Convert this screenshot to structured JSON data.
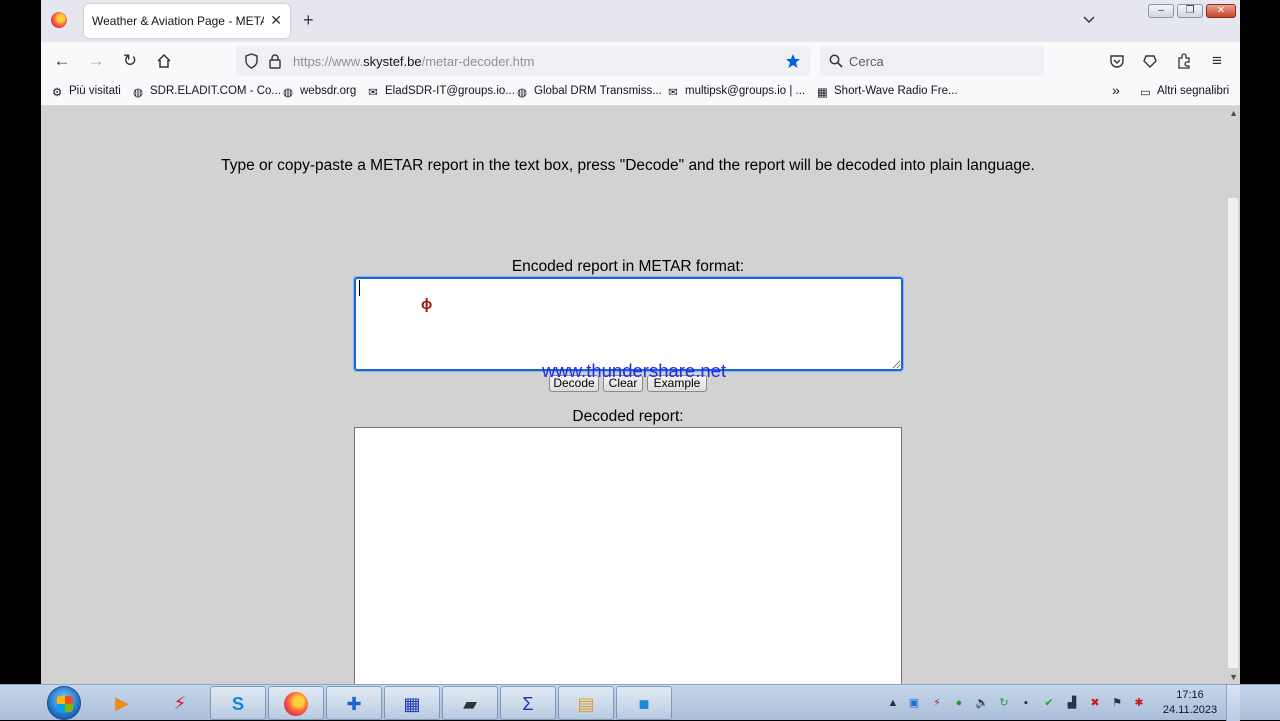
{
  "browser": {
    "tab_title": "Weather & Aviation Page - METAR",
    "tab_close": "✕",
    "new_tab": "+",
    "url_prefix": "https://www.",
    "url_domain": "skystef.be",
    "url_path": "/metar-decoder.htm",
    "search_placeholder": "Cerca",
    "window_buttons": {
      "minimize": "–",
      "maximize": "❐",
      "close": "✕"
    }
  },
  "bookmarks": [
    {
      "label": "Più visitati",
      "icon": "gear-icon"
    },
    {
      "label": "SDR.ELADIT.COM - Co...",
      "icon": "globe-icon"
    },
    {
      "label": "websdr.org",
      "icon": "globe-icon"
    },
    {
      "label": "EladSDR-IT@groups.io...",
      "icon": "mail-icon"
    },
    {
      "label": "Global DRM Transmiss...",
      "icon": "globe-icon"
    },
    {
      "label": "multipsk@groups.io | ...",
      "icon": "mail-icon"
    },
    {
      "label": "Short-Wave Radio Fre...",
      "icon": "radio-icon"
    }
  ],
  "bookmarks_more": "»",
  "bookmarks_other": "Altri segnalibri",
  "page": {
    "intro": "Type or copy-paste a METAR report in the text box, press \"Decode\" and the report will be decoded into plain language.",
    "encoded_label": "Encoded report in METAR format:",
    "encoded_value": "",
    "watermark": "www.thundershare.net",
    "buttons": {
      "decode": "Decode",
      "clear": "Clear",
      "example": "Example"
    },
    "decoded_label": "Decoded report:",
    "cursor_glyph": "ϕ"
  },
  "taskbar": {
    "clock_time": "17:16",
    "clock_date": "24.11.2023",
    "tray_expand": "▲"
  },
  "colors": {
    "page_bg": "#d2d2d2",
    "focus_border": "#1c66d8",
    "watermark": "#1e2ce6",
    "bookmark_star": "#0061e0"
  }
}
